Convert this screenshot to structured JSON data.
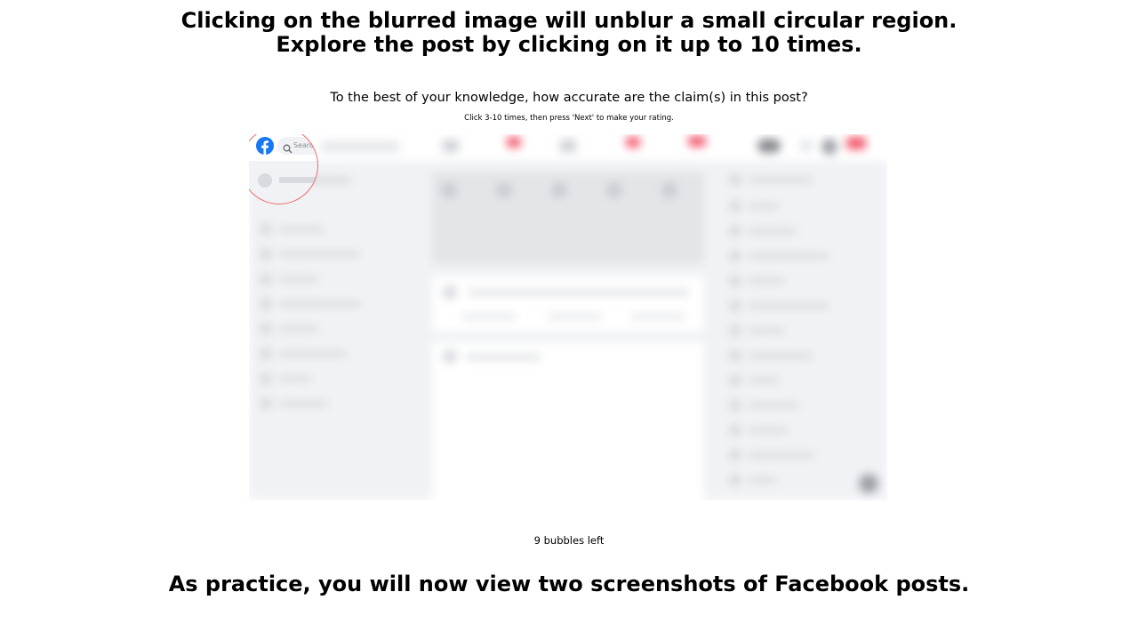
{
  "instructions": {
    "line1": "Clicking on the blurred image will unblur a small circular region.",
    "line2": "Explore the post by clicking on it up to 10 times."
  },
  "question": "To the best of your knowledge, how accurate are the claim(s) in this post?",
  "subnote": "Click 3-10 times, then press 'Next' to make your rating.",
  "post_image": {
    "search_placeholder": "Search",
    "icons": [
      "facebook-logo-icon",
      "search-icon"
    ],
    "colors": {
      "facebook_blue": "#1877f2",
      "reveal_ring": "#f26b6b",
      "notification_red": "#f02849"
    }
  },
  "bubbles_left": "9 bubbles left",
  "footer": "As practice, you will now view two screenshots of Facebook posts."
}
